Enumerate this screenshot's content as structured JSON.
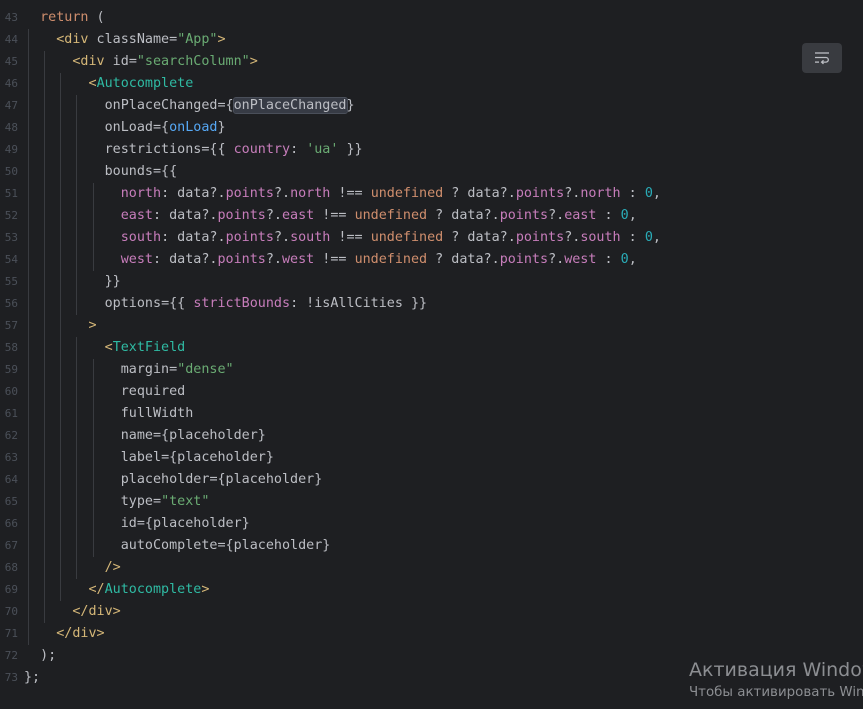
{
  "editor": {
    "lines": [
      {
        "num": "43",
        "depth": 0,
        "tokens": [
          [
            "kw",
            "  return"
          ],
          [
            "punc",
            " ("
          ]
        ]
      },
      {
        "num": "44",
        "depth": 1,
        "tokens": [
          [
            "punc",
            "    "
          ],
          [
            "tag",
            "<div"
          ],
          [
            "attr",
            " className"
          ],
          [
            "punc",
            "="
          ],
          [
            "str",
            "\"App\""
          ],
          [
            "tag",
            ">"
          ]
        ]
      },
      {
        "num": "45",
        "depth": 2,
        "tokens": [
          [
            "punc",
            "      "
          ],
          [
            "tag",
            "<div"
          ],
          [
            "attr",
            " id"
          ],
          [
            "punc",
            "="
          ],
          [
            "str",
            "\"searchColumn\""
          ],
          [
            "tag",
            ">"
          ]
        ]
      },
      {
        "num": "46",
        "depth": 3,
        "tokens": [
          [
            "punc",
            "        "
          ],
          [
            "tag",
            "<"
          ],
          [
            "comp",
            "Autocomplete"
          ]
        ]
      },
      {
        "num": "47",
        "depth": 4,
        "tokens": [
          [
            "punc",
            "          "
          ],
          [
            "attr",
            "onPlaceChanged"
          ],
          [
            "punc",
            "={"
          ],
          [
            "hl",
            "onPlaceChanged"
          ],
          [
            "punc",
            "}"
          ]
        ]
      },
      {
        "num": "48",
        "depth": 4,
        "tokens": [
          [
            "punc",
            "          "
          ],
          [
            "attr",
            "onLoad"
          ],
          [
            "punc",
            "={"
          ],
          [
            "ref",
            "onLoad"
          ],
          [
            "punc",
            "}"
          ]
        ]
      },
      {
        "num": "49",
        "depth": 4,
        "tokens": [
          [
            "punc",
            "          "
          ],
          [
            "attr",
            "restrictions"
          ],
          [
            "punc",
            "={{ "
          ],
          [
            "prop",
            "country"
          ],
          [
            "punc",
            ": "
          ],
          [
            "str",
            "'ua'"
          ],
          [
            "punc",
            " }}"
          ]
        ]
      },
      {
        "num": "50",
        "depth": 4,
        "tokens": [
          [
            "punc",
            "          "
          ],
          [
            "attr",
            "bounds"
          ],
          [
            "punc",
            "={{"
          ]
        ]
      },
      {
        "num": "51",
        "depth": 5,
        "tokens": [
          [
            "punc",
            "            "
          ],
          [
            "prop",
            "north"
          ],
          [
            "punc",
            ": data?."
          ],
          [
            "prop",
            "points"
          ],
          [
            "punc",
            "?."
          ],
          [
            "prop",
            "north"
          ],
          [
            "punc",
            " !== "
          ],
          [
            "kw",
            "undefined"
          ],
          [
            "punc",
            " ? data?."
          ],
          [
            "prop",
            "points"
          ],
          [
            "punc",
            "?."
          ],
          [
            "prop",
            "north"
          ],
          [
            "punc",
            " : "
          ],
          [
            "num",
            "0"
          ],
          [
            "punc",
            ","
          ]
        ]
      },
      {
        "num": "52",
        "depth": 5,
        "tokens": [
          [
            "punc",
            "            "
          ],
          [
            "prop",
            "east"
          ],
          [
            "punc",
            ": data?."
          ],
          [
            "prop",
            "points"
          ],
          [
            "punc",
            "?."
          ],
          [
            "prop",
            "east"
          ],
          [
            "punc",
            " !== "
          ],
          [
            "kw",
            "undefined"
          ],
          [
            "punc",
            " ? data?."
          ],
          [
            "prop",
            "points"
          ],
          [
            "punc",
            "?."
          ],
          [
            "prop",
            "east"
          ],
          [
            "punc",
            " : "
          ],
          [
            "num",
            "0"
          ],
          [
            "punc",
            ","
          ]
        ]
      },
      {
        "num": "53",
        "depth": 5,
        "tokens": [
          [
            "punc",
            "            "
          ],
          [
            "prop",
            "south"
          ],
          [
            "punc",
            ": data?."
          ],
          [
            "prop",
            "points"
          ],
          [
            "punc",
            "?."
          ],
          [
            "prop",
            "south"
          ],
          [
            "punc",
            " !== "
          ],
          [
            "kw",
            "undefined"
          ],
          [
            "punc",
            " ? data?."
          ],
          [
            "prop",
            "points"
          ],
          [
            "punc",
            "?."
          ],
          [
            "prop",
            "south"
          ],
          [
            "punc",
            " : "
          ],
          [
            "num",
            "0"
          ],
          [
            "punc",
            ","
          ]
        ]
      },
      {
        "num": "54",
        "depth": 5,
        "tokens": [
          [
            "punc",
            "            "
          ],
          [
            "prop",
            "west"
          ],
          [
            "punc",
            ": data?."
          ],
          [
            "prop",
            "points"
          ],
          [
            "punc",
            "?."
          ],
          [
            "prop",
            "west"
          ],
          [
            "punc",
            " !== "
          ],
          [
            "kw",
            "undefined"
          ],
          [
            "punc",
            " ? data?."
          ],
          [
            "prop",
            "points"
          ],
          [
            "punc",
            "?."
          ],
          [
            "prop",
            "west"
          ],
          [
            "punc",
            " : "
          ],
          [
            "num",
            "0"
          ],
          [
            "punc",
            ","
          ]
        ]
      },
      {
        "num": "55",
        "depth": 4,
        "tokens": [
          [
            "punc",
            "          }}"
          ]
        ]
      },
      {
        "num": "56",
        "depth": 4,
        "tokens": [
          [
            "punc",
            "          "
          ],
          [
            "attr",
            "options"
          ],
          [
            "punc",
            "={{ "
          ],
          [
            "prop",
            "strictBounds"
          ],
          [
            "punc",
            ": !isAllCities }}"
          ]
        ]
      },
      {
        "num": "57",
        "depth": 3,
        "tokens": [
          [
            "punc",
            "        "
          ],
          [
            "tag",
            ">"
          ]
        ]
      },
      {
        "num": "58",
        "depth": 4,
        "tokens": [
          [
            "punc",
            "          "
          ],
          [
            "tag",
            "<"
          ],
          [
            "comp",
            "TextField"
          ]
        ]
      },
      {
        "num": "59",
        "depth": 5,
        "tokens": [
          [
            "punc",
            "            "
          ],
          [
            "attr",
            "margin"
          ],
          [
            "punc",
            "="
          ],
          [
            "str",
            "\"dense\""
          ]
        ]
      },
      {
        "num": "60",
        "depth": 5,
        "tokens": [
          [
            "punc",
            "            "
          ],
          [
            "attr",
            "required"
          ]
        ]
      },
      {
        "num": "61",
        "depth": 5,
        "tokens": [
          [
            "punc",
            "            "
          ],
          [
            "attr",
            "fullWidth"
          ]
        ]
      },
      {
        "num": "62",
        "depth": 5,
        "tokens": [
          [
            "punc",
            "            "
          ],
          [
            "attr",
            "name"
          ],
          [
            "punc",
            "={placeholder}"
          ]
        ]
      },
      {
        "num": "63",
        "depth": 5,
        "tokens": [
          [
            "punc",
            "            "
          ],
          [
            "attr",
            "label"
          ],
          [
            "punc",
            "={placeholder}"
          ]
        ]
      },
      {
        "num": "64",
        "depth": 5,
        "tokens": [
          [
            "punc",
            "            "
          ],
          [
            "attr",
            "placeholder"
          ],
          [
            "punc",
            "={placeholder}"
          ]
        ]
      },
      {
        "num": "65",
        "depth": 5,
        "tokens": [
          [
            "punc",
            "            "
          ],
          [
            "attr",
            "type"
          ],
          [
            "punc",
            "="
          ],
          [
            "str",
            "\"text\""
          ]
        ]
      },
      {
        "num": "66",
        "depth": 5,
        "tokens": [
          [
            "punc",
            "            "
          ],
          [
            "attr",
            "id"
          ],
          [
            "punc",
            "={placeholder}"
          ]
        ]
      },
      {
        "num": "67",
        "depth": 5,
        "tokens": [
          [
            "punc",
            "            "
          ],
          [
            "attr",
            "autoComplete"
          ],
          [
            "punc",
            "={placeholder}"
          ]
        ]
      },
      {
        "num": "68",
        "depth": 4,
        "tokens": [
          [
            "punc",
            "          "
          ],
          [
            "tag",
            "/>"
          ]
        ]
      },
      {
        "num": "69",
        "depth": 3,
        "tokens": [
          [
            "punc",
            "        "
          ],
          [
            "tag",
            "</"
          ],
          [
            "comp",
            "Autocomplete"
          ],
          [
            "tag",
            ">"
          ]
        ]
      },
      {
        "num": "70",
        "depth": 2,
        "tokens": [
          [
            "punc",
            "      "
          ],
          [
            "tag",
            "</div>"
          ]
        ]
      },
      {
        "num": "71",
        "depth": 1,
        "tokens": [
          [
            "punc",
            "    "
          ],
          [
            "tag",
            "</div>"
          ]
        ]
      },
      {
        "num": "72",
        "depth": 0,
        "tokens": [
          [
            "punc",
            "  );"
          ]
        ]
      },
      {
        "num": "73",
        "depth": 0,
        "tokens": [
          [
            "punc",
            "};"
          ]
        ]
      }
    ]
  },
  "toolbar": {
    "wrap_icon": "soft-wrap-icon"
  },
  "activation": {
    "title": "Активация Windows",
    "subtitle": "Чтобы активировать Windows"
  },
  "colors": {
    "background": "#1e1f22",
    "keyword": "#cf8e6d",
    "tag": "#d5b778",
    "component": "#2fbaa3",
    "string": "#6aab73",
    "property": "#c77dbb",
    "number": "#2aacb8",
    "reference": "#56a8f5"
  }
}
